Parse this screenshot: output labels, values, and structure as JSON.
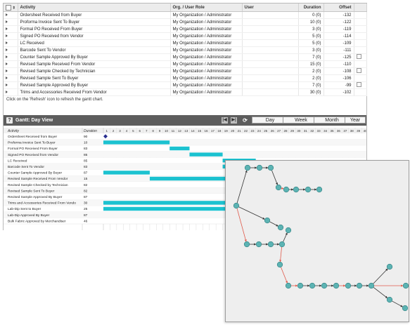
{
  "table": {
    "columns": {
      "activity": "Activity",
      "role": "Org. / User Role",
      "user": "User",
      "duration": "Duration",
      "offset": "Offset"
    },
    "rows": [
      {
        "activity": "Ordersheet Received from Buyer",
        "role": "My Organization / Administrator",
        "user": "",
        "duration": "0 (0)",
        "offset": "-132",
        "doc": false
      },
      {
        "activity": "Proforma Invoice Sent To Buyer",
        "role": "My Organization / Administrator",
        "user": "",
        "duration": "10 (0)",
        "offset": "-122",
        "doc": false
      },
      {
        "activity": "Formal PO Received From Buyer",
        "role": "My Organization / Administrator",
        "user": "",
        "duration": "3 (0)",
        "offset": "-119",
        "doc": false
      },
      {
        "activity": "Signed PO Received from Vendor",
        "role": "My Organization / Administrator",
        "user": "",
        "duration": "5 (0)",
        "offset": "-114",
        "doc": false
      },
      {
        "activity": "LC Received",
        "role": "My Organization / Administrator",
        "user": "",
        "duration": "5 (0)",
        "offset": "-109",
        "doc": false
      },
      {
        "activity": "Barcode Sent To Vendor",
        "role": "My Organization / Administrator",
        "user": "",
        "duration": "3 (0)",
        "offset": "-111",
        "doc": false
      },
      {
        "activity": "Counter Sample Approved By Buyer",
        "role": "My Organization / Administrator",
        "user": "",
        "duration": "7 (0)",
        "offset": "-125",
        "doc": true
      },
      {
        "activity": "Revised Sample Received From Vendor",
        "role": "My Organization / Administrator",
        "user": "",
        "duration": "15 (0)",
        "offset": "-110",
        "doc": false
      },
      {
        "activity": "Revised Sample Checked by Technician",
        "role": "My Organization / Administrator",
        "user": "",
        "duration": "2 (0)",
        "offset": "-108",
        "doc": true
      },
      {
        "activity": "Revised Sample Sent To Buyer",
        "role": "My Organization / Administrator",
        "user": "",
        "duration": "2 (0)",
        "offset": "-106",
        "doc": false
      },
      {
        "activity": "Revised Sample Approved By Buyer",
        "role": "My Organization / Administrator",
        "user": "",
        "duration": "7 (0)",
        "offset": "-99",
        "doc": true
      },
      {
        "activity": "Trims and Accessories Received From Vendor",
        "role": "My Organization / Administrator",
        "user": "",
        "duration": "30 (0)",
        "offset": "-102",
        "doc": false
      }
    ]
  },
  "hint": "Click on the 'Refresh' icon to refresh the gantt chart.",
  "gantt": {
    "help_label": "?",
    "title": "Gantt: Day View",
    "nav": {
      "first": "|◀",
      "last": "▶|",
      "refresh": "⟳"
    },
    "views": [
      "Day",
      "Week",
      "Month",
      "Year"
    ],
    "col_activity": "Activity",
    "col_duration": "Duration",
    "bar_color": "#1cc2d0",
    "milestone_color": "#2a2f8f",
    "rows": [
      {
        "activity": "Ordersheet Received from Buyer",
        "duration": "90",
        "start": 0,
        "days": 0
      },
      {
        "activity": "Proforma Invoice Sent To Buyer",
        "duration": "10",
        "start": 0,
        "days": 10
      },
      {
        "activity": "Formal PO Received From Buyer",
        "duration": "83",
        "start": 10,
        "days": 3
      },
      {
        "activity": "Signed PO Received from Vendor",
        "duration": "85",
        "start": 13,
        "days": 5
      },
      {
        "activity": "LC Received",
        "duration": "85",
        "start": 18,
        "days": 5
      },
      {
        "activity": "Barcode Sent To Vendor",
        "duration": "83",
        "start": 18,
        "days": 3
      },
      {
        "activity": "Counter Sample Approved By Buyer",
        "duration": "87",
        "start": 0,
        "days": 7
      },
      {
        "activity": "Revised Sample Received From Vendor",
        "duration": "15",
        "start": 7,
        "days": 15
      },
      {
        "activity": "Revised Sample Checked by Technician",
        "duration": "82",
        "start": 22,
        "days": 2
      },
      {
        "activity": "Revised Sample Sent To Buyer",
        "duration": "82",
        "start": 24,
        "days": 2
      },
      {
        "activity": "Revised Sample Approved By Buyer",
        "duration": "87",
        "start": 26,
        "days": 7
      },
      {
        "activity": "Trims and Accessories Received From Vendo",
        "duration": "30",
        "start": 0,
        "days": 30
      },
      {
        "activity": "Lab-Dip Sent to Buyer",
        "duration": "25",
        "start": 0,
        "days": 25
      },
      {
        "activity": "Lab-Dip Approved By Buyer",
        "duration": "87",
        "start": 25,
        "days": 7
      },
      {
        "activity": "Bulk Fabric Approved by Merchandiser",
        "duration": "46",
        "start": 32,
        "days": 4
      }
    ],
    "day_count": 40
  },
  "network": {
    "node_color": "#5cb3b3",
    "edge_color": "#333333",
    "critical_edge_color": "#e05a4b"
  }
}
